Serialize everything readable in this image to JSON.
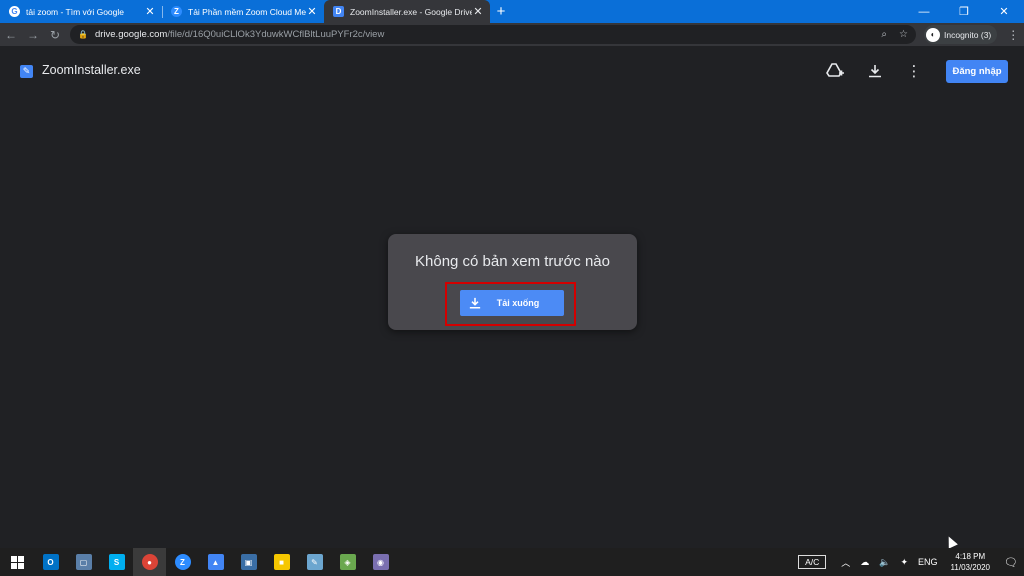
{
  "tabs": [
    {
      "title": "tải zoom - Tìm với Google",
      "favicon": "G",
      "favicon_color": "#ffffff",
      "active": false
    },
    {
      "title": "Tải Phần mềm Zoom Cloud Meetings",
      "favicon": "Z",
      "favicon_color": "#2d8cff",
      "active": false
    },
    {
      "title": "ZoomInstaller.exe - Google Drive",
      "favicon": "D",
      "favicon_color": "#4285f4",
      "active": true
    }
  ],
  "address": {
    "host": "drive.google.com",
    "path": "/file/d/16Q0uiCLlOk3YduwkWCflBltLuuPYFr2c/view"
  },
  "incognito_label": "Incognito (3)",
  "drive": {
    "file_name": "ZoomInstaller.exe",
    "signin_label": "Đăng nhập"
  },
  "preview": {
    "message": "Không có bản xem trước nào",
    "download_label": "Tải xuống"
  },
  "taskbar": {
    "apps": [
      {
        "name": "outlook",
        "glyph": "O",
        "color": "#0072c6"
      },
      {
        "name": "files",
        "glyph": "▢",
        "color": "#5a7fa8"
      },
      {
        "name": "skype",
        "glyph": "S",
        "color": "#00aff0"
      },
      {
        "name": "chrome",
        "glyph": "●",
        "color": "#db4437"
      },
      {
        "name": "zoom",
        "glyph": "Z",
        "color": "#2d8cff"
      },
      {
        "name": "drive",
        "glyph": "▲",
        "color": "#4285f4"
      },
      {
        "name": "computer",
        "glyph": "▣",
        "color": "#3a6ea5"
      },
      {
        "name": "sticky-notes",
        "glyph": "■",
        "color": "#f6c700"
      },
      {
        "name": "notepad",
        "glyph": "✎",
        "color": "#6ca6cf"
      },
      {
        "name": "vmware",
        "glyph": "◈",
        "color": "#6aa84f"
      },
      {
        "name": "vpn",
        "glyph": "◉",
        "color": "#7a6fb0"
      }
    ],
    "ac_label": "A/C",
    "lang": "ENG",
    "time": "4:18 PM",
    "date": "11/03/2020"
  }
}
